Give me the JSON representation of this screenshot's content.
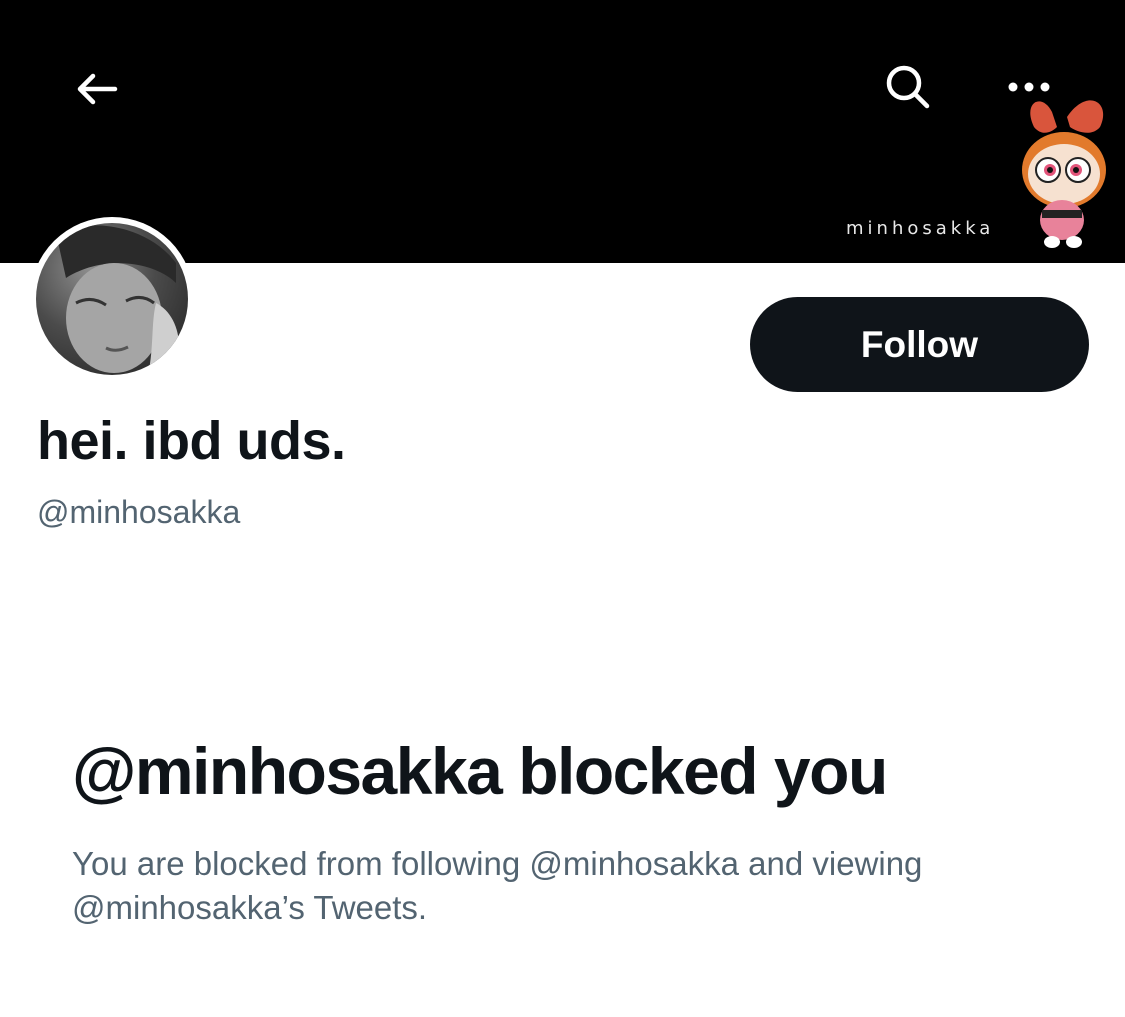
{
  "header": {
    "back_icon": "arrow-left-icon",
    "search_icon": "search-icon",
    "more_icon": "more-horizontal-icon",
    "banner_watermark": "minhosakka",
    "banner_colors": {
      "background": "#000000"
    }
  },
  "profile": {
    "display_name": "hei. ibd uds.",
    "handle": "@minhosakka",
    "follow_label": "Follow"
  },
  "blocked": {
    "title": "@minhosakka blocked you",
    "description": "You are blocked from following @minhosakka and viewing @minhosakka’s Tweets."
  },
  "colors": {
    "text_primary": "#0f1419",
    "text_secondary": "#536471",
    "button_bg": "#0f1419"
  }
}
